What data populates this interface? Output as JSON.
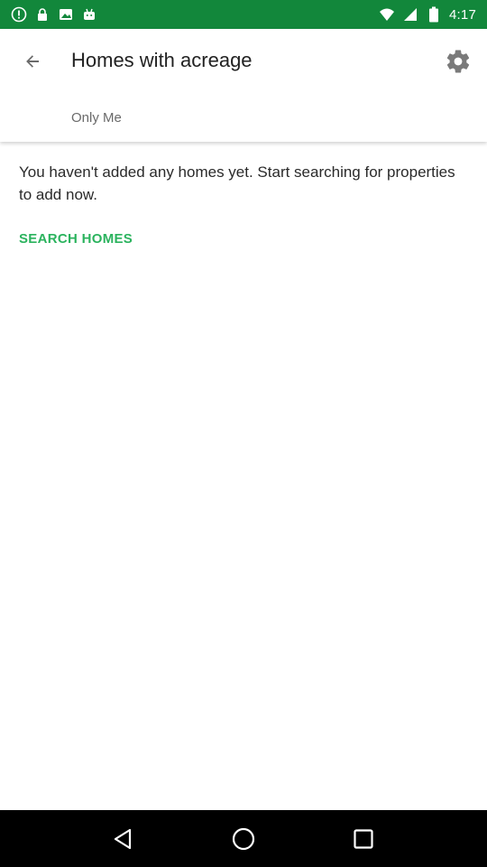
{
  "status_bar": {
    "time": "4:17",
    "icons": [
      "alert-icon",
      "lock-icon",
      "image-icon",
      "android-icon"
    ],
    "background_color": "#12873b"
  },
  "app_bar": {
    "title": "Homes with acreage",
    "subtitle": "Only Me",
    "back_icon": "arrow-left-icon",
    "settings_icon": "gear-icon"
  },
  "main": {
    "empty_message": "You haven't added any homes yet. Start searching for properties to add now.",
    "search_link": "SEARCH HOMES",
    "accent_color": "#2bb35e"
  },
  "nav_bar": {
    "icons": [
      "back-triangle-icon",
      "home-circle-icon",
      "recents-square-icon"
    ]
  }
}
